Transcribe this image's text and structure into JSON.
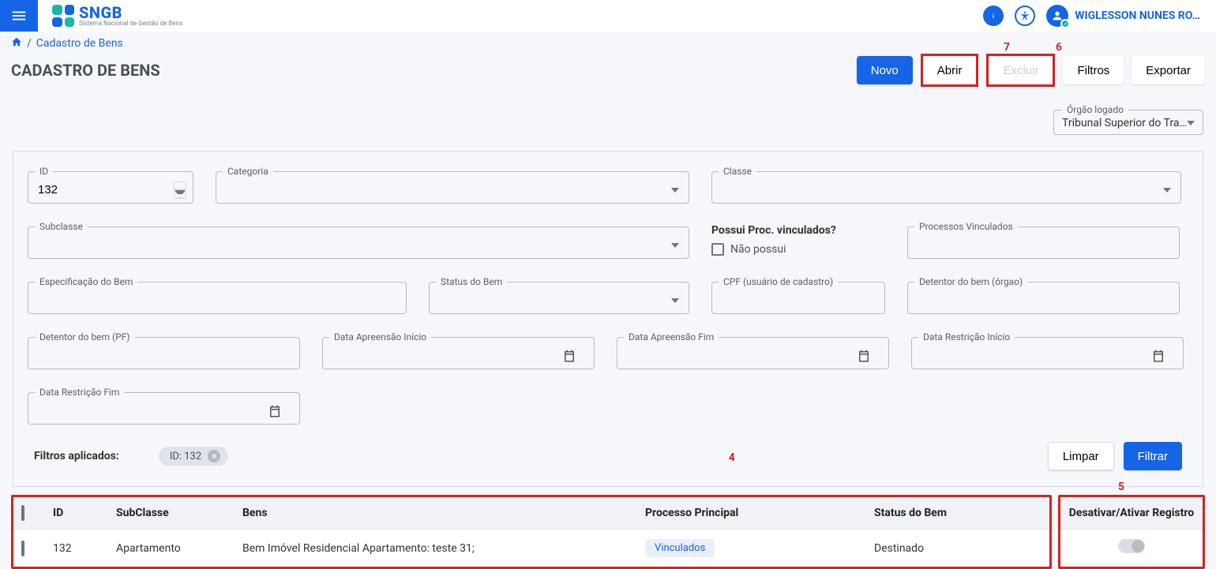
{
  "header": {
    "logo_acronym": "SNGB",
    "logo_sub": "Sistema Nacional de Gestão de Bens",
    "user_name": "WIGLESSON NUNES RO…"
  },
  "breadcrumb": {
    "current": "Cadastro de Bens"
  },
  "page": {
    "title": "CADASTRO DE BENS"
  },
  "actions": {
    "novo": "Novo",
    "abrir": "Abrir",
    "excluir": "Excluir",
    "filtros": "Filtros",
    "exportar": "Exportar"
  },
  "annotations": {
    "a4": "4",
    "a5": "5",
    "a6": "6",
    "a7": "7"
  },
  "org": {
    "label": "Órgão logado",
    "value": "Tribunal Superior do Tra…"
  },
  "filters": {
    "id_label": "ID",
    "id_value": "132",
    "categoria_label": "Categoria",
    "classe_label": "Classe",
    "subclasse_label": "Subclasse",
    "possui_label": "Possui Proc. vinculados?",
    "possui_option": "Não possui",
    "proc_vinc_label": "Processos Vinculados",
    "espec_label": "Especificação do Bem",
    "status_label": "Status do Bem",
    "cpf_label": "CPF (usuário de cadastro)",
    "detentor_orgao_label": "Detentor do bem (órgao)",
    "detentor_pf_label": "Detentor do bem (PF)",
    "data_apreensao_inicio_label": "Data Apreensão Início",
    "data_apreensao_fim_label": "Data Apreensão Fim",
    "data_restricao_inicio_label": "Data Restrição Início",
    "data_restricao_fim_label": "Data Restrição Fim"
  },
  "applied": {
    "label": "Filtros aplicados:",
    "chip": "ID: 132",
    "limpar": "Limpar",
    "filtrar": "Filtrar"
  },
  "table": {
    "headers": {
      "id": "ID",
      "subclasse": "SubClasse",
      "bens": "Bens",
      "processo": "Processo Principal",
      "status": "Status do Bem",
      "toggle": "Desativar/Ativar Registro"
    },
    "rows": [
      {
        "id": "132",
        "subclasse": "Apartamento",
        "bens": "Bem Imóvel Residencial Apartamento: teste 31;",
        "processo_badge": "Vinculados",
        "status": "Destinado"
      }
    ]
  }
}
